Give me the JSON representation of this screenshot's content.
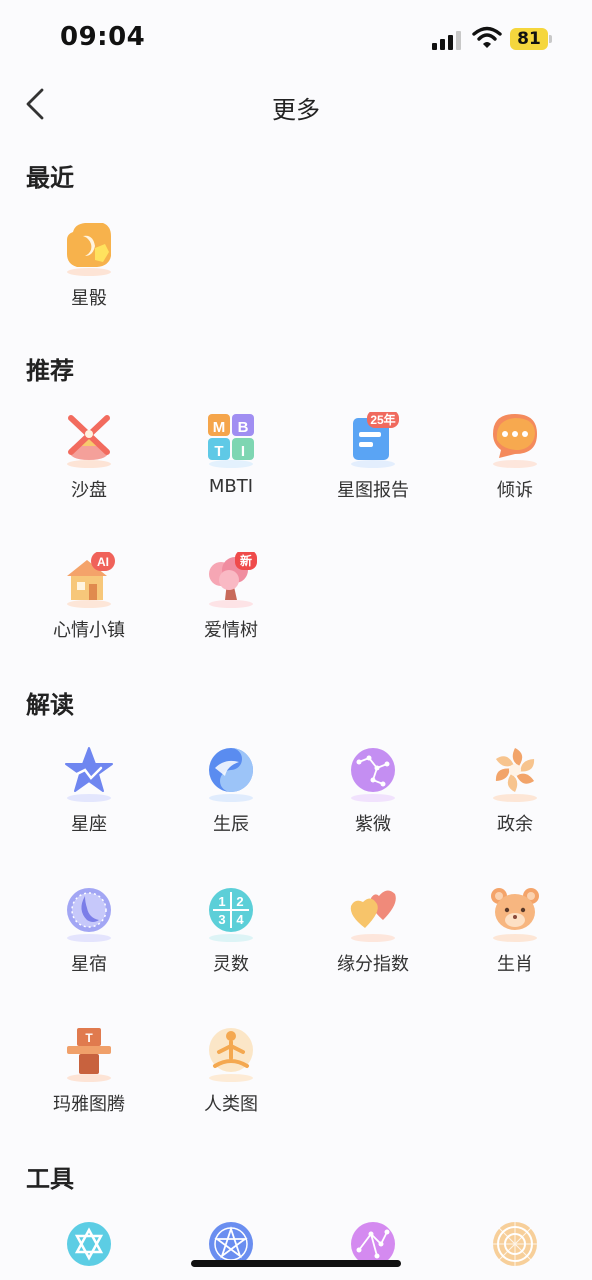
{
  "status": {
    "time": "09:04",
    "battery": "81"
  },
  "nav": {
    "title": "更多"
  },
  "sections": {
    "recent": {
      "title": "最近",
      "items": [
        {
          "label": "星骰",
          "icon": "dice-icon"
        }
      ]
    },
    "recommend": {
      "title": "推荐",
      "items": [
        {
          "label": "沙盘",
          "icon": "sandbox-windmill-icon"
        },
        {
          "label": "MBTI",
          "icon": "mbti-icon",
          "letters": [
            "M",
            "B",
            "T",
            "I"
          ]
        },
        {
          "label": "星图报告",
          "icon": "report-icon",
          "badge": "25年"
        },
        {
          "label": "倾诉",
          "icon": "chat-bubble-icon"
        },
        {
          "label": "心情小镇",
          "icon": "town-house-icon",
          "badge": "AI"
        },
        {
          "label": "爱情树",
          "icon": "love-tree-icon",
          "badge": "新"
        }
      ]
    },
    "reading": {
      "title": "解读",
      "items": [
        {
          "label": "星座",
          "icon": "star-icon"
        },
        {
          "label": "生辰",
          "icon": "yin-yang-icon"
        },
        {
          "label": "紫微",
          "icon": "constellation-icon"
        },
        {
          "label": "政余",
          "icon": "flower-wheel-icon"
        },
        {
          "label": "星宿",
          "icon": "moon-dial-icon"
        },
        {
          "label": "灵数",
          "icon": "numbers-icon",
          "digits": [
            "1",
            "2",
            "3",
            "4"
          ]
        },
        {
          "label": "缘分指数",
          "icon": "hearts-icon"
        },
        {
          "label": "生肖",
          "icon": "mouse-icon"
        },
        {
          "label": "玛雅图腾",
          "icon": "totem-icon",
          "mark": "T"
        },
        {
          "label": "人类图",
          "icon": "human-meditate-icon"
        }
      ]
    },
    "tools": {
      "title": "工具",
      "items": [
        {
          "icon": "hexagram-icon"
        },
        {
          "icon": "pentagram-wheel-icon"
        },
        {
          "icon": "star-map-icon"
        },
        {
          "icon": "compass-wheel-icon"
        }
      ]
    }
  }
}
